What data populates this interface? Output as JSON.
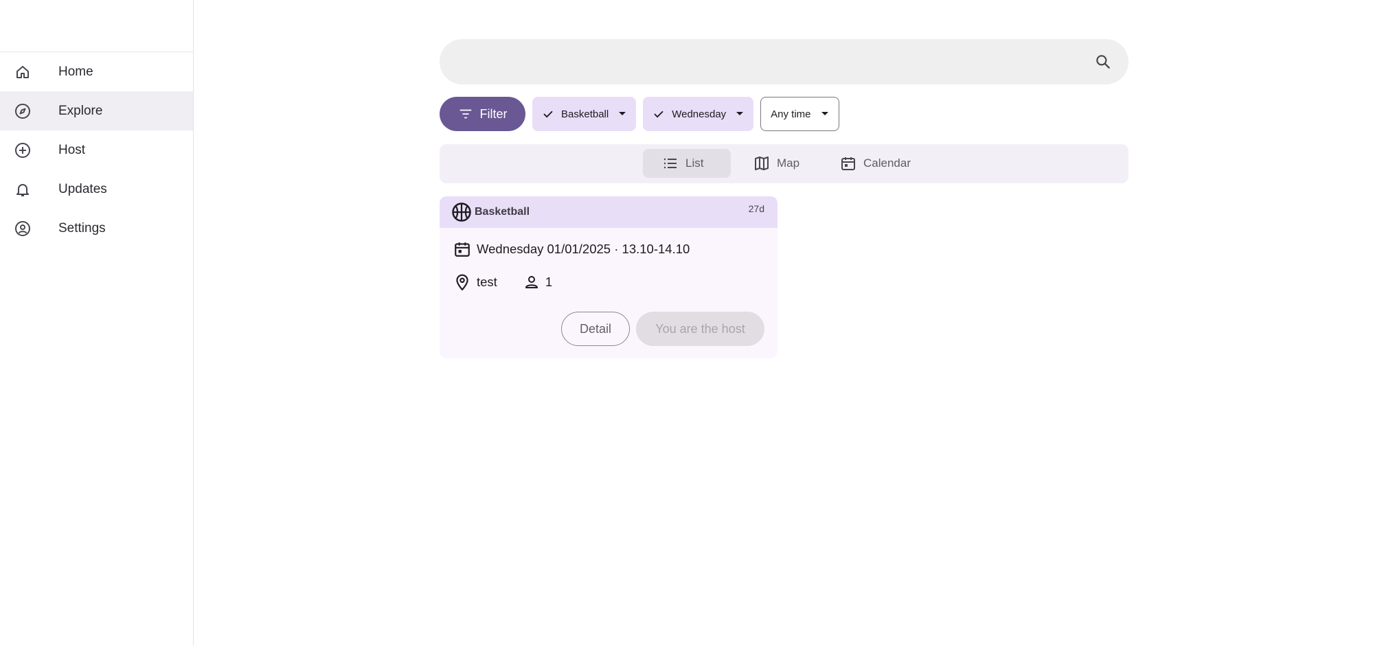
{
  "sidebar": {
    "items": [
      {
        "label": "Home",
        "icon": "home-icon",
        "active": false
      },
      {
        "label": "Explore",
        "icon": "compass-icon",
        "active": true
      },
      {
        "label": "Host",
        "icon": "plus-circle-icon",
        "active": false
      },
      {
        "label": "Updates",
        "icon": "bell-icon",
        "active": false
      },
      {
        "label": "Settings",
        "icon": "account-circle-icon",
        "active": false
      }
    ]
  },
  "search": {
    "placeholder": "",
    "value": ""
  },
  "filters": {
    "filter_label": "Filter",
    "chips": [
      {
        "label": "Basketball",
        "selected": true
      },
      {
        "label": "Wednesday",
        "selected": true
      },
      {
        "label": "Any time",
        "selected": false
      }
    ]
  },
  "views": {
    "list": "List",
    "map": "Map",
    "calendar": "Calendar",
    "active": "List"
  },
  "events": [
    {
      "sport": "Basketball",
      "age": "27d",
      "datetime": "Wednesday 01/01/2025 · 13.10-14.10",
      "location": "test",
      "participants": "1",
      "detail_label": "Detail",
      "host_label": "You are the host"
    }
  ],
  "colors": {
    "primary": "#6a5894",
    "chip_selected": "#e9def8",
    "card_bg": "#fbf6fe",
    "nav_active": "#f0eef3"
  }
}
